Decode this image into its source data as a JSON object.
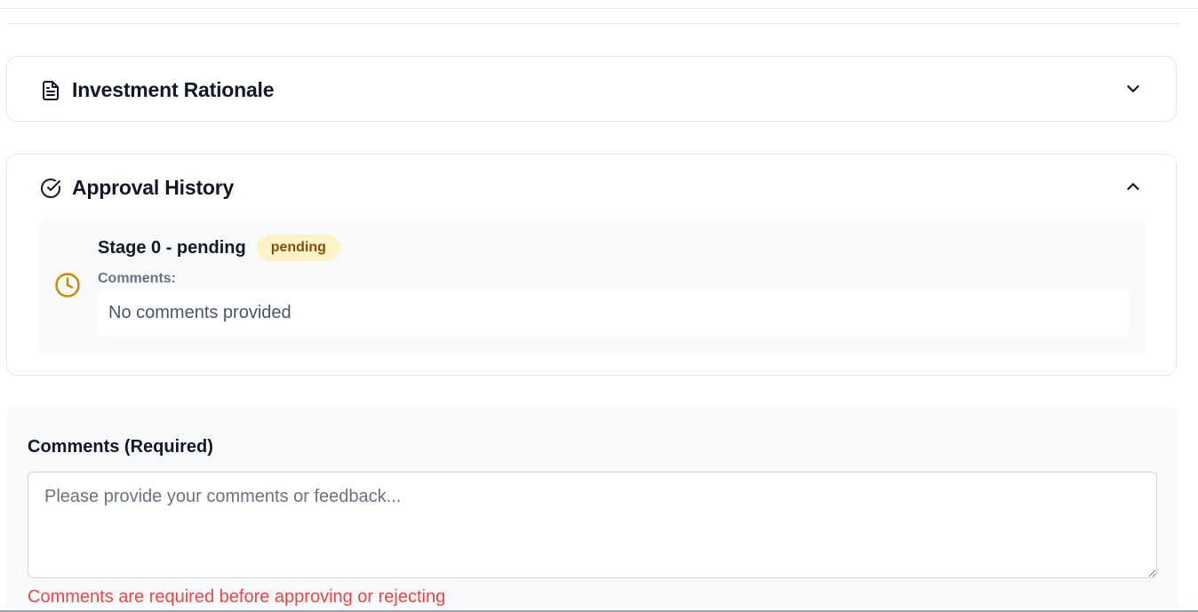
{
  "sections": {
    "rationale": {
      "title": "Investment Rationale",
      "icon": "document-icon",
      "expanded": false
    },
    "approval_history": {
      "title": "Approval History",
      "icon": "check-circle-icon",
      "expanded": true,
      "stages": [
        {
          "title": "Stage 0 - pending",
          "status": "pending",
          "status_color": "#fef3c7",
          "status_text_color": "#854d0e",
          "icon": "clock-icon",
          "icon_color": "#ca8a04",
          "comments_label": "Comments:",
          "comments": "No comments provided"
        }
      ]
    }
  },
  "comment_form": {
    "label": "Comments (Required)",
    "value": "",
    "placeholder": "Please provide your comments or feedback...",
    "error": "Comments are required before approving or rejecting",
    "error_color": "#ef4444"
  }
}
